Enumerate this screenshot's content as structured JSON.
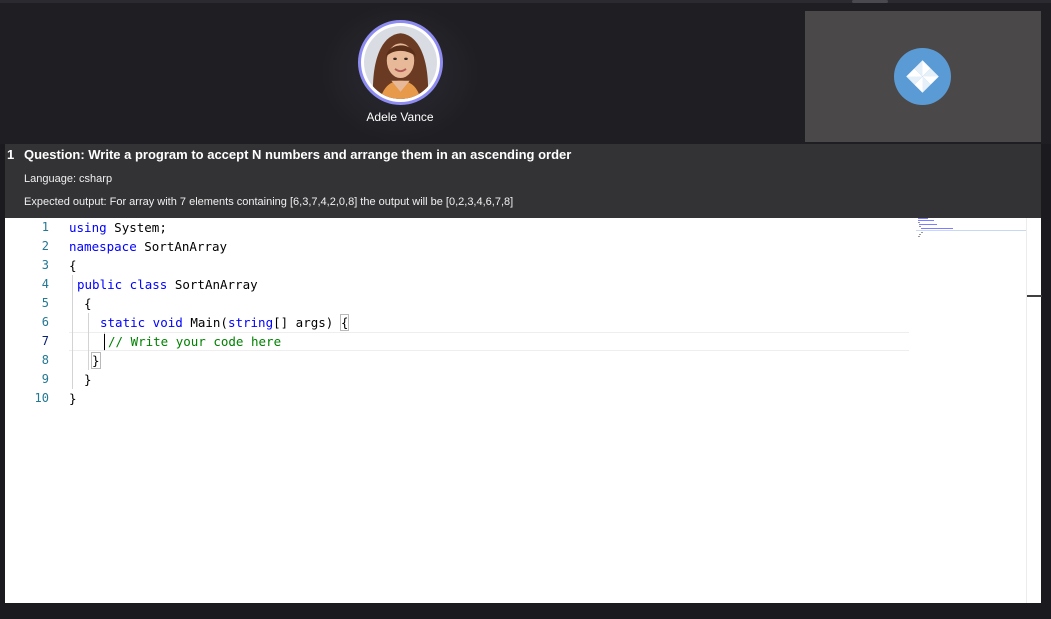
{
  "participant": {
    "name": "Adele Vance"
  },
  "self_tile": {
    "logo_icon": "teams-logo-icon"
  },
  "question": {
    "number": "1",
    "title": "Question: Write a program to accept N numbers and arrange them in an ascending order",
    "language": "Language: csharp",
    "expected_output": "Expected output: For array with 7 elements containing [6,3,7,4,2,0,8] the output will be [0,2,3,4,6,7,8]"
  },
  "editor": {
    "line_numbers": [
      "1",
      "2",
      "3",
      "4",
      "5",
      "6",
      "7",
      "8",
      "9",
      "10"
    ],
    "active_line": 7,
    "code": {
      "l1_kw": "using",
      "l1_rest": " System;",
      "l2_kw": "namespace",
      "l2_rest": " SortAnArray",
      "l3": "{",
      "l4_kw": "public class",
      "l4_rest": " SortAnArray",
      "l5": "{",
      "l6_kw": "static void",
      "l6_mid": " Main(",
      "l6_kw2": "string",
      "l6_rest": "[] args) ",
      "l6_brace": "{",
      "l7_comment": "// Write your code here",
      "l8": "}",
      "l9": "}",
      "l10": "}"
    }
  },
  "colors": {
    "keyword": "#0000ff",
    "comment": "#008000",
    "line_number": "#237893",
    "avatar_ring": "#8e8cf0",
    "logo": "#5b9bd5"
  }
}
